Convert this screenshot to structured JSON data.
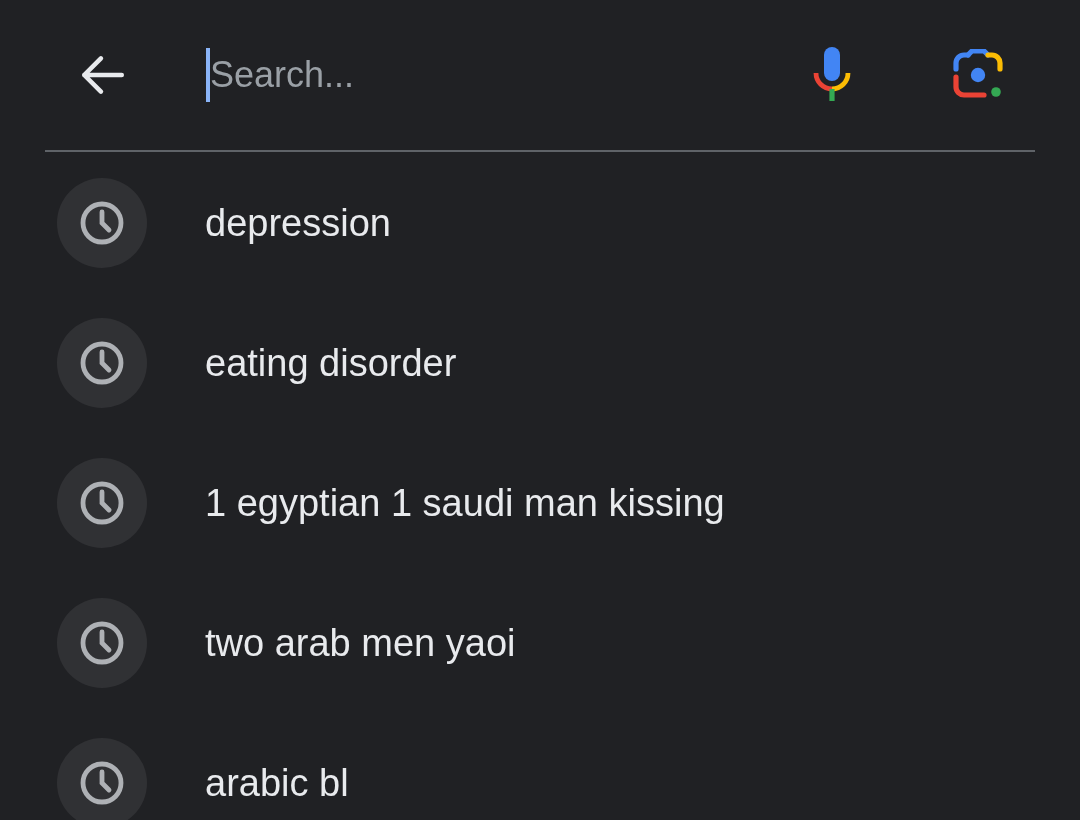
{
  "search": {
    "placeholder": "Search..."
  },
  "history": [
    {
      "text": "depression"
    },
    {
      "text": "eating disorder"
    },
    {
      "text": "1 egyptian 1 saudi man kissing"
    },
    {
      "text": "two arab men yaoi"
    },
    {
      "text": "arabic bl"
    }
  ]
}
